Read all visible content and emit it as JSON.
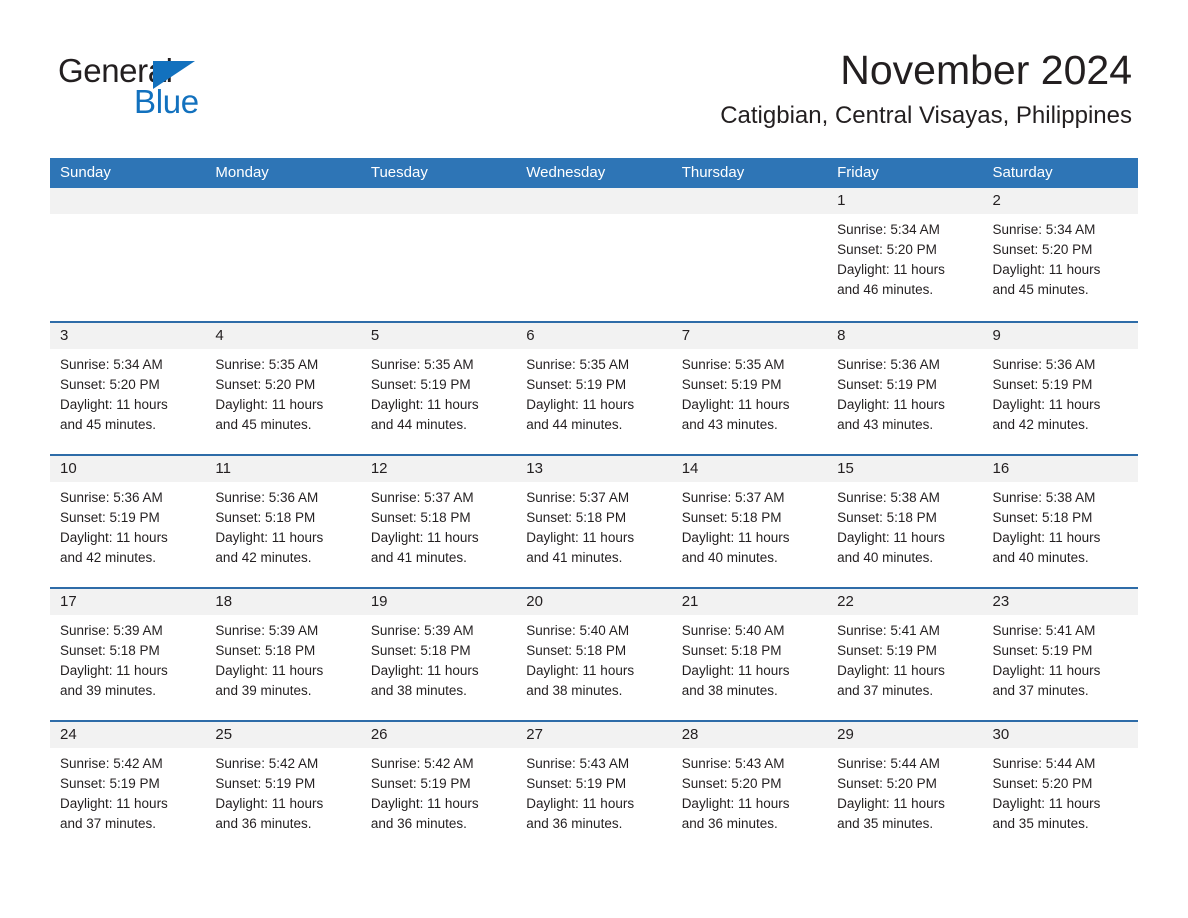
{
  "brand": {
    "word_one": "General",
    "word_two": "Blue",
    "triangle_color": "#1271be"
  },
  "header": {
    "title": "November 2024",
    "subtitle": "Catigbian, Central Visayas, Philippines"
  },
  "colors": {
    "header_blue": "#2e75b6",
    "row_rule_blue": "#2e6ca8",
    "date_band_gray": "#f2f2f2",
    "text": "#231f20"
  },
  "weekdays": [
    "Sunday",
    "Monday",
    "Tuesday",
    "Wednesday",
    "Thursday",
    "Friday",
    "Saturday"
  ],
  "weeks": [
    [
      {
        "day": "",
        "sunrise": "",
        "sunset": "",
        "daylight": "",
        "daylight2": ""
      },
      {
        "day": "",
        "sunrise": "",
        "sunset": "",
        "daylight": "",
        "daylight2": ""
      },
      {
        "day": "",
        "sunrise": "",
        "sunset": "",
        "daylight": "",
        "daylight2": ""
      },
      {
        "day": "",
        "sunrise": "",
        "sunset": "",
        "daylight": "",
        "daylight2": ""
      },
      {
        "day": "",
        "sunrise": "",
        "sunset": "",
        "daylight": "",
        "daylight2": ""
      },
      {
        "day": "1",
        "sunrise": "Sunrise: 5:34 AM",
        "sunset": "Sunset: 5:20 PM",
        "daylight": "Daylight: 11 hours",
        "daylight2": "and 46 minutes."
      },
      {
        "day": "2",
        "sunrise": "Sunrise: 5:34 AM",
        "sunset": "Sunset: 5:20 PM",
        "daylight": "Daylight: 11 hours",
        "daylight2": "and 45 minutes."
      }
    ],
    [
      {
        "day": "3",
        "sunrise": "Sunrise: 5:34 AM",
        "sunset": "Sunset: 5:20 PM",
        "daylight": "Daylight: 11 hours",
        "daylight2": "and 45 minutes."
      },
      {
        "day": "4",
        "sunrise": "Sunrise: 5:35 AM",
        "sunset": "Sunset: 5:20 PM",
        "daylight": "Daylight: 11 hours",
        "daylight2": "and 45 minutes."
      },
      {
        "day": "5",
        "sunrise": "Sunrise: 5:35 AM",
        "sunset": "Sunset: 5:19 PM",
        "daylight": "Daylight: 11 hours",
        "daylight2": "and 44 minutes."
      },
      {
        "day": "6",
        "sunrise": "Sunrise: 5:35 AM",
        "sunset": "Sunset: 5:19 PM",
        "daylight": "Daylight: 11 hours",
        "daylight2": "and 44 minutes."
      },
      {
        "day": "7",
        "sunrise": "Sunrise: 5:35 AM",
        "sunset": "Sunset: 5:19 PM",
        "daylight": "Daylight: 11 hours",
        "daylight2": "and 43 minutes."
      },
      {
        "day": "8",
        "sunrise": "Sunrise: 5:36 AM",
        "sunset": "Sunset: 5:19 PM",
        "daylight": "Daylight: 11 hours",
        "daylight2": "and 43 minutes."
      },
      {
        "day": "9",
        "sunrise": "Sunrise: 5:36 AM",
        "sunset": "Sunset: 5:19 PM",
        "daylight": "Daylight: 11 hours",
        "daylight2": "and 42 minutes."
      }
    ],
    [
      {
        "day": "10",
        "sunrise": "Sunrise: 5:36 AM",
        "sunset": "Sunset: 5:19 PM",
        "daylight": "Daylight: 11 hours",
        "daylight2": "and 42 minutes."
      },
      {
        "day": "11",
        "sunrise": "Sunrise: 5:36 AM",
        "sunset": "Sunset: 5:18 PM",
        "daylight": "Daylight: 11 hours",
        "daylight2": "and 42 minutes."
      },
      {
        "day": "12",
        "sunrise": "Sunrise: 5:37 AM",
        "sunset": "Sunset: 5:18 PM",
        "daylight": "Daylight: 11 hours",
        "daylight2": "and 41 minutes."
      },
      {
        "day": "13",
        "sunrise": "Sunrise: 5:37 AM",
        "sunset": "Sunset: 5:18 PM",
        "daylight": "Daylight: 11 hours",
        "daylight2": "and 41 minutes."
      },
      {
        "day": "14",
        "sunrise": "Sunrise: 5:37 AM",
        "sunset": "Sunset: 5:18 PM",
        "daylight": "Daylight: 11 hours",
        "daylight2": "and 40 minutes."
      },
      {
        "day": "15",
        "sunrise": "Sunrise: 5:38 AM",
        "sunset": "Sunset: 5:18 PM",
        "daylight": "Daylight: 11 hours",
        "daylight2": "and 40 minutes."
      },
      {
        "day": "16",
        "sunrise": "Sunrise: 5:38 AM",
        "sunset": "Sunset: 5:18 PM",
        "daylight": "Daylight: 11 hours",
        "daylight2": "and 40 minutes."
      }
    ],
    [
      {
        "day": "17",
        "sunrise": "Sunrise: 5:39 AM",
        "sunset": "Sunset: 5:18 PM",
        "daylight": "Daylight: 11 hours",
        "daylight2": "and 39 minutes."
      },
      {
        "day": "18",
        "sunrise": "Sunrise: 5:39 AM",
        "sunset": "Sunset: 5:18 PM",
        "daylight": "Daylight: 11 hours",
        "daylight2": "and 39 minutes."
      },
      {
        "day": "19",
        "sunrise": "Sunrise: 5:39 AM",
        "sunset": "Sunset: 5:18 PM",
        "daylight": "Daylight: 11 hours",
        "daylight2": "and 38 minutes."
      },
      {
        "day": "20",
        "sunrise": "Sunrise: 5:40 AM",
        "sunset": "Sunset: 5:18 PM",
        "daylight": "Daylight: 11 hours",
        "daylight2": "and 38 minutes."
      },
      {
        "day": "21",
        "sunrise": "Sunrise: 5:40 AM",
        "sunset": "Sunset: 5:18 PM",
        "daylight": "Daylight: 11 hours",
        "daylight2": "and 38 minutes."
      },
      {
        "day": "22",
        "sunrise": "Sunrise: 5:41 AM",
        "sunset": "Sunset: 5:19 PM",
        "daylight": "Daylight: 11 hours",
        "daylight2": "and 37 minutes."
      },
      {
        "day": "23",
        "sunrise": "Sunrise: 5:41 AM",
        "sunset": "Sunset: 5:19 PM",
        "daylight": "Daylight: 11 hours",
        "daylight2": "and 37 minutes."
      }
    ],
    [
      {
        "day": "24",
        "sunrise": "Sunrise: 5:42 AM",
        "sunset": "Sunset: 5:19 PM",
        "daylight": "Daylight: 11 hours",
        "daylight2": "and 37 minutes."
      },
      {
        "day": "25",
        "sunrise": "Sunrise: 5:42 AM",
        "sunset": "Sunset: 5:19 PM",
        "daylight": "Daylight: 11 hours",
        "daylight2": "and 36 minutes."
      },
      {
        "day": "26",
        "sunrise": "Sunrise: 5:42 AM",
        "sunset": "Sunset: 5:19 PM",
        "daylight": "Daylight: 11 hours",
        "daylight2": "and 36 minutes."
      },
      {
        "day": "27",
        "sunrise": "Sunrise: 5:43 AM",
        "sunset": "Sunset: 5:19 PM",
        "daylight": "Daylight: 11 hours",
        "daylight2": "and 36 minutes."
      },
      {
        "day": "28",
        "sunrise": "Sunrise: 5:43 AM",
        "sunset": "Sunset: 5:20 PM",
        "daylight": "Daylight: 11 hours",
        "daylight2": "and 36 minutes."
      },
      {
        "day": "29",
        "sunrise": "Sunrise: 5:44 AM",
        "sunset": "Sunset: 5:20 PM",
        "daylight": "Daylight: 11 hours",
        "daylight2": "and 35 minutes."
      },
      {
        "day": "30",
        "sunrise": "Sunrise: 5:44 AM",
        "sunset": "Sunset: 5:20 PM",
        "daylight": "Daylight: 11 hours",
        "daylight2": "and 35 minutes."
      }
    ]
  ]
}
